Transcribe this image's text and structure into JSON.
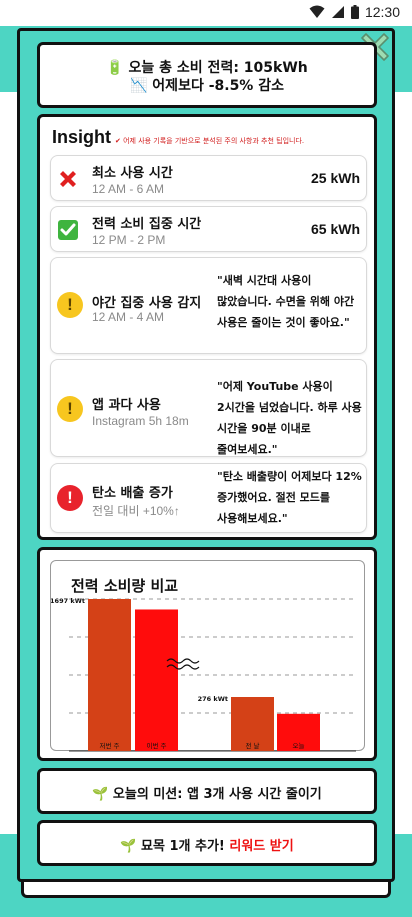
{
  "status": {
    "time": "12:30"
  },
  "summary": {
    "line1": "🔋 오늘 총 소비 전력: 105kWh",
    "line2": "📉 어제보다 -8.5% 감소"
  },
  "insight": {
    "title": "Insight",
    "subtitle": "✔ 어제 사용 기록을 기반으로 분석된 주의 사항과 추천 팁입니다.",
    "items": [
      {
        "icon": "red-x-icon",
        "title": "최소 사용 시간",
        "sub": "12 AM - 6 AM",
        "value": "25 kWh"
      },
      {
        "icon": "green-check-icon",
        "title": "전력 소비 집중 시간",
        "sub": "12 PM - 2 PM",
        "value": "65 kWh"
      },
      {
        "icon": "yellow-warning-icon",
        "title": "야간 집중 사용 감지",
        "sub": "12 AM - 4 AM",
        "quote": "\"새벽 시간대 사용이 많았습니다. 수면을 위해 야간 사용은 줄이는 것이 좋아요.\""
      },
      {
        "icon": "yellow-warning-icon",
        "title": "앱 과다 사용",
        "sub": "Instagram 5h 18m",
        "quote": "\"어제 YouTube 사용이 2시간을 넘었습니다. 하루 사용 시간을 90분 이내로 줄여보세요.\""
      },
      {
        "icon": "red-alert-icon",
        "title": "탄소 배출 증가",
        "sub": "전일 대비 +10%↑",
        "quote": "\"탄소 배출량이 어제보다 12% 증가했어요. 절전 모드를 사용해보세요.\""
      }
    ]
  },
  "chart_data": {
    "type": "bar",
    "title": "전력 소비량 비교",
    "categories": [
      "저번 주",
      "이번 주",
      "전 날",
      "오늘"
    ],
    "values": [
      1697,
      1580,
      276,
      190
    ],
    "data_labels": [
      "1697 kWt",
      "",
      "276 kWt",
      ""
    ],
    "bar_colors": [
      "#d44117",
      "#ff0c0c",
      "#d44117",
      "#ff0c0c"
    ],
    "axis_break": true,
    "grid": true
  },
  "mission": {
    "text": "🌱 오늘의 미션: 앱 3개 사용 시간 줄이기"
  },
  "reward": {
    "prefix": "🌱 묘목 1개 추가! ",
    "link": "리워드 받기"
  }
}
